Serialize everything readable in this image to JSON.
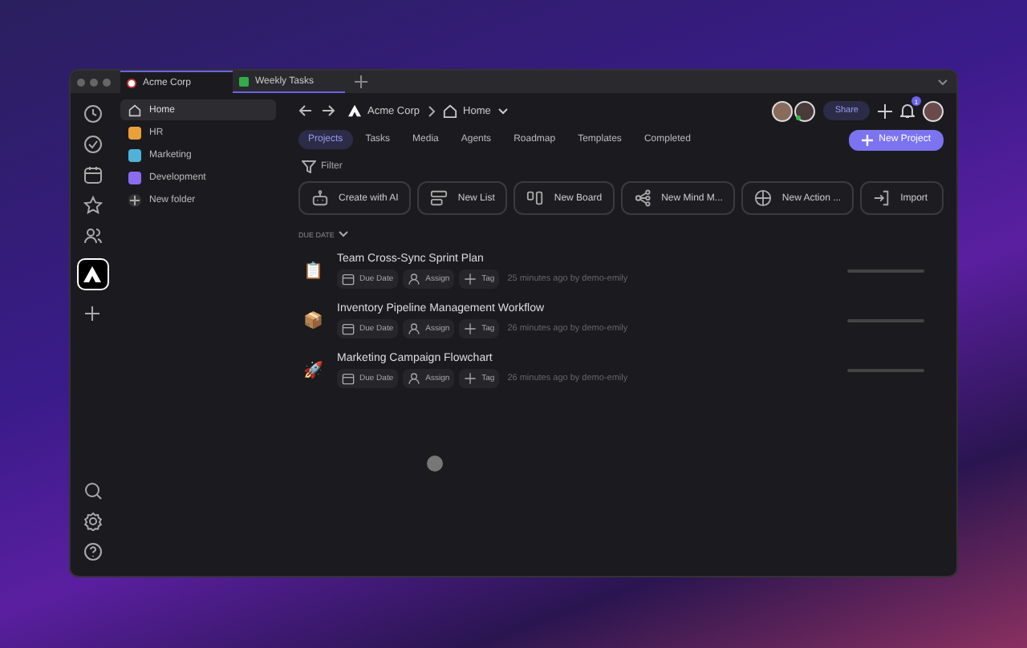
{
  "window": {
    "tabs": [
      {
        "label": "Acme Corp",
        "selected": true,
        "kind": "workspace"
      },
      {
        "label": "Weekly Tasks",
        "selected": false,
        "kind": "task"
      }
    ]
  },
  "sidebar": {
    "items": [
      {
        "label": "Home",
        "kind": "home",
        "selected": true
      },
      {
        "label": "HR",
        "kind": "folder",
        "color": "#e9a03b",
        "selected": false
      },
      {
        "label": "Marketing",
        "kind": "folder",
        "color": "#4fb3d9",
        "selected": false
      },
      {
        "label": "Development",
        "kind": "folder",
        "color": "#8b6cf0",
        "selected": false
      },
      {
        "label": "New folder",
        "kind": "add",
        "selected": false
      }
    ]
  },
  "breadcrumb": [
    "Acme Corp",
    "Home"
  ],
  "header": {
    "share": "Share",
    "notification_count": "1"
  },
  "tabs": [
    {
      "label": "Projects",
      "selected": true
    },
    {
      "label": "Tasks",
      "selected": false
    },
    {
      "label": "Media",
      "selected": false
    },
    {
      "label": "Agents",
      "selected": false
    },
    {
      "label": "Roadmap",
      "selected": false
    },
    {
      "label": "Templates",
      "selected": false
    },
    {
      "label": "Completed",
      "selected": false
    }
  ],
  "new_project": "New Project",
  "filter": "Filter",
  "actions": [
    "Create with AI",
    "New List",
    "New Board",
    "New Mind M...",
    "New Action ...",
    "Import"
  ],
  "group": "DUE DATE",
  "projects": [
    {
      "title": "Team Cross-Sync Sprint Plan",
      "emoji": "📋",
      "due": "Due Date",
      "assign": "Assign",
      "tag": "Tag",
      "meta": "25 minutes ago by demo-emily"
    },
    {
      "title": "Inventory Pipeline Management Workflow",
      "emoji": "📦",
      "due": "Due Date",
      "assign": "Assign",
      "tag": "Tag",
      "meta": "26 minutes ago by demo-emily"
    },
    {
      "title": "Marketing Campaign Flowchart",
      "emoji": "🚀",
      "due": "Due Date",
      "assign": "Assign",
      "tag": "Tag",
      "meta": "26 minutes ago by demo-emily"
    }
  ]
}
